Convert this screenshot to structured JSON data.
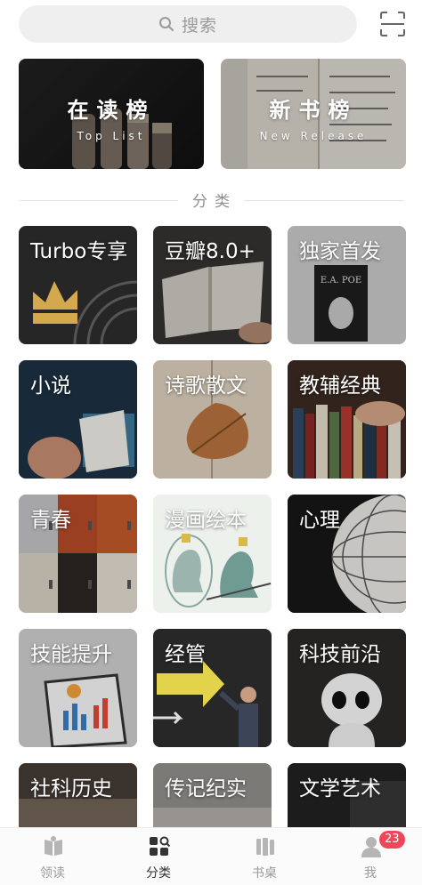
{
  "search": {
    "placeholder": "搜索",
    "icon": "search-icon"
  },
  "scan": {
    "icon": "scan-icon"
  },
  "banners": [
    {
      "title": "在读榜",
      "subtitle": "Top List"
    },
    {
      "title": "新书榜",
      "subtitle": "New Release"
    }
  ],
  "section_title": "分类",
  "categories": [
    {
      "label": "Turbo专享"
    },
    {
      "label": "豆瓣8.0+"
    },
    {
      "label": "独家首发"
    },
    {
      "label": "小说"
    },
    {
      "label": "诗歌散文"
    },
    {
      "label": "教辅经典"
    },
    {
      "label": "青春"
    },
    {
      "label": "漫画绘本"
    },
    {
      "label": "心理"
    },
    {
      "label": "技能提升"
    },
    {
      "label": "经管"
    },
    {
      "label": "科技前沿"
    },
    {
      "label": "社科历史"
    },
    {
      "label": "传记纪实"
    },
    {
      "label": "文学艺术"
    }
  ],
  "tile_art": {
    "book_cover_title": "E.A. POE"
  },
  "nav": [
    {
      "label": "领读",
      "icon": "read-book-icon"
    },
    {
      "label": "分类",
      "icon": "category-grid-icon",
      "active": true
    },
    {
      "label": "书桌",
      "icon": "bookshelf-icon"
    },
    {
      "label": "我",
      "icon": "profile-icon"
    }
  ],
  "badge": {
    "count": "23"
  },
  "colors": {
    "accent_badge": "#f0465a",
    "nav_active": "#333333",
    "nav_inactive": "#9a9a9a"
  }
}
